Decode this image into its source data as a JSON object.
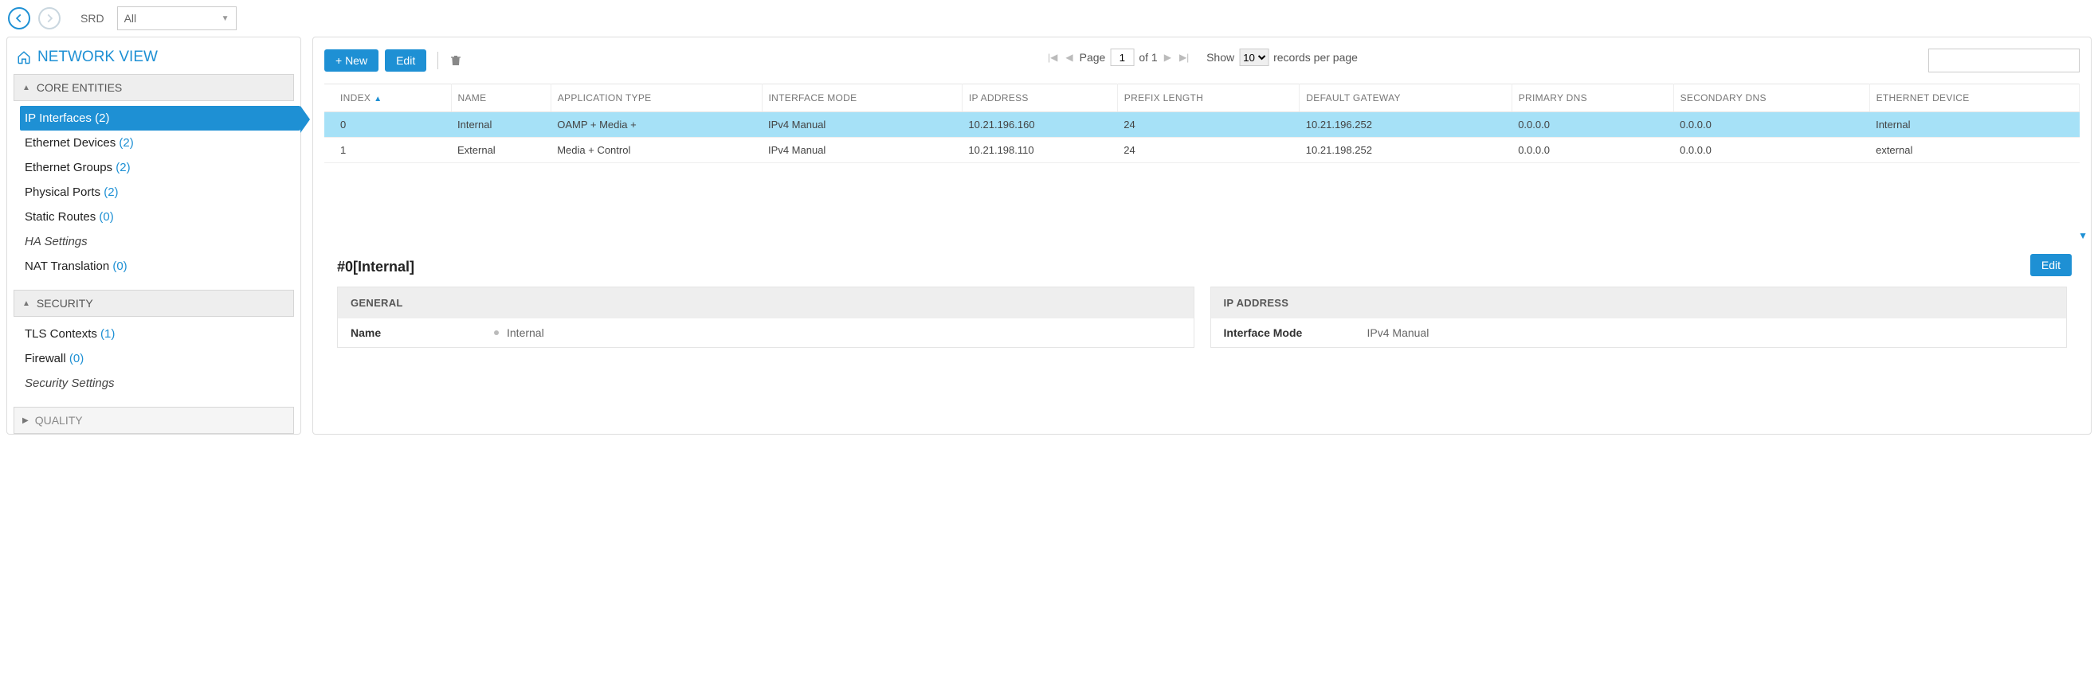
{
  "topbar": {
    "srd_label": "SRD",
    "srd_value": "All"
  },
  "sidebar": {
    "title": "NETWORK VIEW",
    "sections": [
      {
        "label": "CORE ENTITIES",
        "expanded": true,
        "items": [
          {
            "label": "IP Interfaces",
            "count": "(2)",
            "selected": true
          },
          {
            "label": "Ethernet Devices",
            "count": "(2)"
          },
          {
            "label": "Ethernet Groups",
            "count": "(2)"
          },
          {
            "label": "Physical Ports",
            "count": "(2)"
          },
          {
            "label": "Static Routes",
            "count": "(0)"
          },
          {
            "label": "HA Settings",
            "italic": true
          },
          {
            "label": "NAT Translation",
            "count": "(0)"
          }
        ]
      },
      {
        "label": "SECURITY",
        "expanded": true,
        "items": [
          {
            "label": "TLS Contexts",
            "count": "(1)"
          },
          {
            "label": "Firewall",
            "count": "(0)"
          },
          {
            "label": "Security Settings",
            "italic": true
          }
        ]
      },
      {
        "label": "QUALITY",
        "expanded": false
      }
    ]
  },
  "toolbar": {
    "new_label": "+ New",
    "edit_label": "Edit"
  },
  "pager": {
    "page_label": "Page",
    "page_value": "1",
    "of_label": "of 1",
    "show_label": "Show",
    "show_value": "10",
    "records_label": "records per page"
  },
  "table": {
    "headers": {
      "index": "INDEX",
      "name": "NAME",
      "app_type": "APPLICATION TYPE",
      "if_mode": "INTERFACE MODE",
      "ip": "IP ADDRESS",
      "prefix": "PREFIX LENGTH",
      "gateway": "DEFAULT GATEWAY",
      "dns1": "PRIMARY DNS",
      "dns2": "SECONDARY DNS",
      "ethdev": "ETHERNET DEVICE"
    },
    "rows": [
      {
        "index": "0",
        "name": "Internal",
        "app_type": "OAMP + Media +",
        "if_mode": "IPv4 Manual",
        "ip": "10.21.196.160",
        "prefix": "24",
        "gateway": "10.21.196.252",
        "dns1": "0.0.0.0",
        "dns2": "0.0.0.0",
        "ethdev": "Internal",
        "selected": true
      },
      {
        "index": "1",
        "name": "External",
        "app_type": "Media + Control",
        "if_mode": "IPv4 Manual",
        "ip": "10.21.198.110",
        "prefix": "24",
        "gateway": "10.21.198.252",
        "dns1": "0.0.0.0",
        "dns2": "0.0.0.0",
        "ethdev": "external"
      }
    ]
  },
  "detail": {
    "title": "#0[Internal]",
    "edit_label": "Edit",
    "cards": {
      "general": {
        "header": "GENERAL",
        "name_label": "Name",
        "name_value": "Internal"
      },
      "ipaddr": {
        "header": "IP ADDRESS",
        "mode_label": "Interface Mode",
        "mode_value": "IPv4 Manual"
      }
    }
  }
}
